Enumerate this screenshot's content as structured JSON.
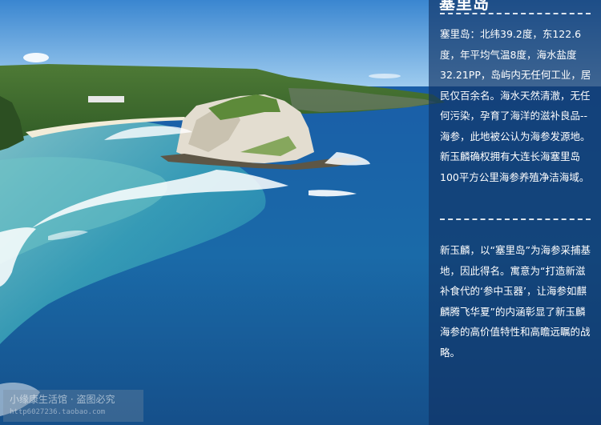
{
  "island": {
    "title": "塞里岛",
    "intro": "塞里岛：北纬39.2度，东122.6度，年平均气温8度，海水盐度32.21PP，岛屿内无任何工业，居民仅百余名。海水天然清澈，无任何污染，孕育了海洋的滋补良品--海参，此地被公认为海参发源地。新玉麟确权拥有大连长海塞里岛100平方公里海参养殖净洁海域。",
    "brand": "新玉麟，以“塞里岛”为海参采捕基地，因此得名。寓意为“打造新滋补食代的‘参中玉器’，让海参如麒麟腾飞华夏”的内涵彰显了新玉麟海参的高价值特性和高瞻远瞩的战略。"
  },
  "watermark": {
    "line1": "小缘康生活馆 · 盗图必究",
    "line2": "http6027236.taobao.com"
  },
  "colors": {
    "panel": "#103466",
    "sky": "#4d94d6",
    "sea": "#1b5e9e"
  }
}
